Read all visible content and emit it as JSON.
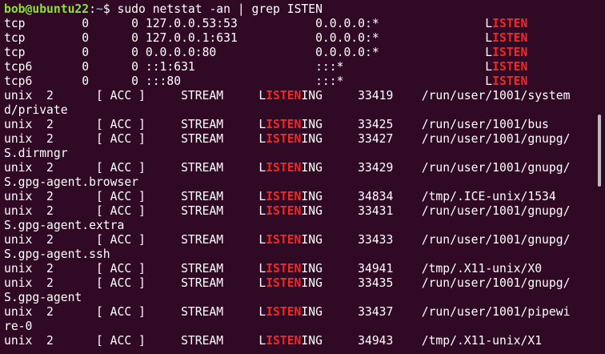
{
  "prompt": {
    "user_host": "bob@ubuntu22",
    "sep": ":",
    "path": "~",
    "symbol": "$",
    "command": "sudo netstat -an | grep ISTEN"
  },
  "highlight_color": "#ef2929",
  "lines": [
    {
      "pre": "tcp        0      0 127.0.0.53:53           0.0.0.0:*               L",
      "hl": "ISTEN",
      "post": ""
    },
    {
      "pre": "tcp        0      0 127.0.0.1:631           0.0.0.0:*               L",
      "hl": "ISTEN",
      "post": ""
    },
    {
      "pre": "tcp        0      0 0.0.0.0:80              0.0.0.0:*               L",
      "hl": "ISTEN",
      "post": ""
    },
    {
      "pre": "tcp6       0      0 ::1:631                 :::*                    L",
      "hl": "ISTEN",
      "post": ""
    },
    {
      "pre": "tcp6       0      0 :::80                   :::*                    L",
      "hl": "ISTEN",
      "post": ""
    },
    {
      "pre": "unix  2      [ ACC ]     STREAM     L",
      "hl": "ISTEN",
      "post": "ING     33419    /run/user/1001/system"
    },
    {
      "pre": "d/private",
      "hl": "",
      "post": ""
    },
    {
      "pre": "unix  2      [ ACC ]     STREAM     L",
      "hl": "ISTEN",
      "post": "ING     33425    /run/user/1001/bus"
    },
    {
      "pre": "unix  2      [ ACC ]     STREAM     L",
      "hl": "ISTEN",
      "post": "ING     33427    /run/user/1001/gnupg/"
    },
    {
      "pre": "S.dirmngr",
      "hl": "",
      "post": ""
    },
    {
      "pre": "unix  2      [ ACC ]     STREAM     L",
      "hl": "ISTEN",
      "post": "ING     33429    /run/user/1001/gnupg/"
    },
    {
      "pre": "S.gpg-agent.browser",
      "hl": "",
      "post": ""
    },
    {
      "pre": "unix  2      [ ACC ]     STREAM     L",
      "hl": "ISTEN",
      "post": "ING     34834    /tmp/.ICE-unix/1534"
    },
    {
      "pre": "unix  2      [ ACC ]     STREAM     L",
      "hl": "ISTEN",
      "post": "ING     33431    /run/user/1001/gnupg/"
    },
    {
      "pre": "S.gpg-agent.extra",
      "hl": "",
      "post": ""
    },
    {
      "pre": "unix  2      [ ACC ]     STREAM     L",
      "hl": "ISTEN",
      "post": "ING     33433    /run/user/1001/gnupg/"
    },
    {
      "pre": "S.gpg-agent.ssh",
      "hl": "",
      "post": ""
    },
    {
      "pre": "unix  2      [ ACC ]     STREAM     L",
      "hl": "ISTEN",
      "post": "ING     34941    /tmp/.X11-unix/X0"
    },
    {
      "pre": "unix  2      [ ACC ]     STREAM     L",
      "hl": "ISTEN",
      "post": "ING     33435    /run/user/1001/gnupg/"
    },
    {
      "pre": "S.gpg-agent",
      "hl": "",
      "post": ""
    },
    {
      "pre": "unix  2      [ ACC ]     STREAM     L",
      "hl": "ISTEN",
      "post": "ING     33437    /run/user/1001/pipewi"
    },
    {
      "pre": "re-0",
      "hl": "",
      "post": ""
    },
    {
      "pre": "unix  2      [ ACC ]     STREAM     L",
      "hl": "ISTEN",
      "post": "ING     34943    /tmp/.X11-unix/X1"
    }
  ]
}
